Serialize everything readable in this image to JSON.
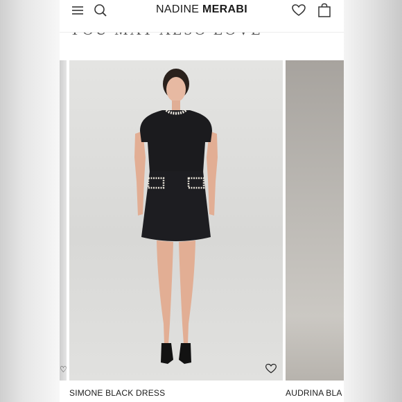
{
  "header": {
    "brand_light": "NADINE ",
    "brand_bold": "MERABI",
    "menu_icon": "hamburger-menu-icon",
    "search_icon": "search-icon",
    "wishlist_icon": "heart-icon",
    "bag_icon": "shopping-bag-icon"
  },
  "section": {
    "title": "YOU MAY ALSO LOVE"
  },
  "products": [
    {
      "name": "SIMONE BLACK DRESS"
    },
    {
      "name": "AUDRINA BLA"
    }
  ],
  "colors": {
    "accent": "#1a1a1a",
    "background": "#ffffff"
  }
}
